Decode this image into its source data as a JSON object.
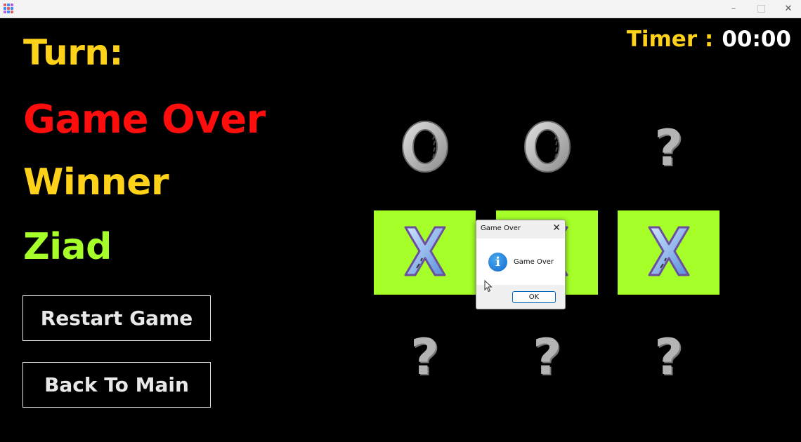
{
  "window": {
    "controls": {
      "minimize": "–",
      "maximize": "",
      "close": "✕"
    },
    "icon_colors": [
      "#e15b64",
      "#3d8bfd",
      "#b85de8",
      "#3d8bfd",
      "#e15b64",
      "#3d8bfd",
      "#b85de8",
      "#3d8bfd",
      "#e15b64"
    ]
  },
  "left_panel": {
    "turn_label": "Turn:",
    "status": "Game Over",
    "result_label": "Winner",
    "winner_name": "Ziad",
    "restart_button": "Restart Game",
    "back_button": "Back To Main"
  },
  "timer": {
    "label": "Timer :",
    "value": "00:00"
  },
  "colors": {
    "accent_yellow": "#ffd21a",
    "status_red": "#ff0d0d",
    "winner_green": "#a6ff28",
    "cell_green": "#a6ff28",
    "button_text": "#e8e8e8"
  },
  "board": {
    "cells": [
      {
        "mark": "O",
        "filled": false
      },
      {
        "mark": "O",
        "filled": false
      },
      {
        "mark": "?",
        "filled": false
      },
      {
        "mark": "X",
        "filled": true
      },
      {
        "mark": "X",
        "filled": true
      },
      {
        "mark": "X",
        "filled": true
      },
      {
        "mark": "?",
        "filled": false
      },
      {
        "mark": "?",
        "filled": false
      },
      {
        "mark": "?",
        "filled": false
      }
    ]
  },
  "dialog": {
    "title": "Game Over",
    "message": "Game Over",
    "ok_label": "OK",
    "close_label": "✕",
    "icon": "info-icon",
    "icon_glyph": "i"
  }
}
